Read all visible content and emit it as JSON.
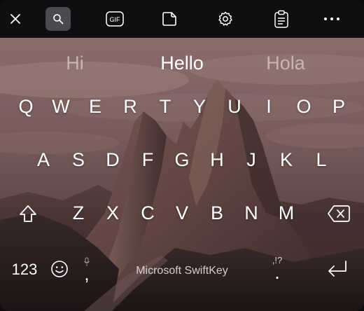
{
  "app": {
    "name": "Microsoft SwiftKey"
  },
  "toolbar": {
    "items": [
      {
        "name": "close",
        "icon": "close-icon"
      },
      {
        "name": "search",
        "icon": "search-icon",
        "active": true
      },
      {
        "name": "gif",
        "icon": "gif-icon",
        "label": "GIF"
      },
      {
        "name": "stickers",
        "icon": "sticker-icon"
      },
      {
        "name": "settings",
        "icon": "gear-icon"
      },
      {
        "name": "clipboard",
        "icon": "clipboard-icon"
      },
      {
        "name": "more",
        "icon": "more-horizontal-icon"
      }
    ]
  },
  "suggestions": [
    "Hi",
    "Hello",
    "Hola"
  ],
  "rows": [
    [
      "Q",
      "W",
      "E",
      "R",
      "T",
      "Y",
      "U",
      "I",
      "O",
      "P"
    ],
    [
      "A",
      "S",
      "D",
      "F",
      "G",
      "H",
      "J",
      "K",
      "L"
    ],
    [
      "Z",
      "X",
      "C",
      "V",
      "B",
      "N",
      "M"
    ]
  ],
  "bottom_row": {
    "numbers_label": "123",
    "comma_label": ",",
    "space_label": "Microsoft SwiftKey",
    "period_label": ".",
    "punctuation_hint": ",!?"
  },
  "colors": {
    "toolbar_bg": "#0f0f11",
    "active_toolbar_bg": "#4a4a50",
    "key_text": "#ffffff"
  }
}
